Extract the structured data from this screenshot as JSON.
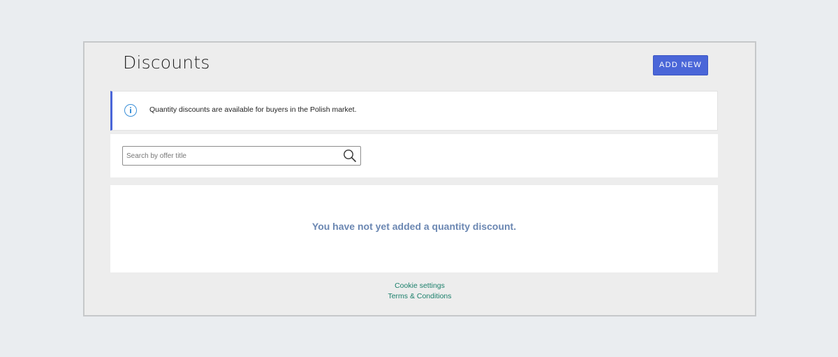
{
  "header": {
    "title": "Discounts",
    "add_button_label": "ADD NEW"
  },
  "info": {
    "icon": "info-icon",
    "message": "Quantity discounts are available for buyers in the Polish market."
  },
  "search": {
    "placeholder": "Search by offer title",
    "value": "",
    "icon": "search-icon"
  },
  "empty_state": {
    "message": "You have not yet added a quantity discount."
  },
  "footer": {
    "links": [
      {
        "label": "Cookie settings"
      },
      {
        "label": "Terms & Conditions"
      }
    ]
  },
  "colors": {
    "accent": "#4a66d8",
    "info_icon": "#3a8fd8",
    "empty_text": "#6b87b2",
    "link": "#1a7f6a",
    "page_background": "#eaedf0",
    "frame_background": "#ededed"
  }
}
